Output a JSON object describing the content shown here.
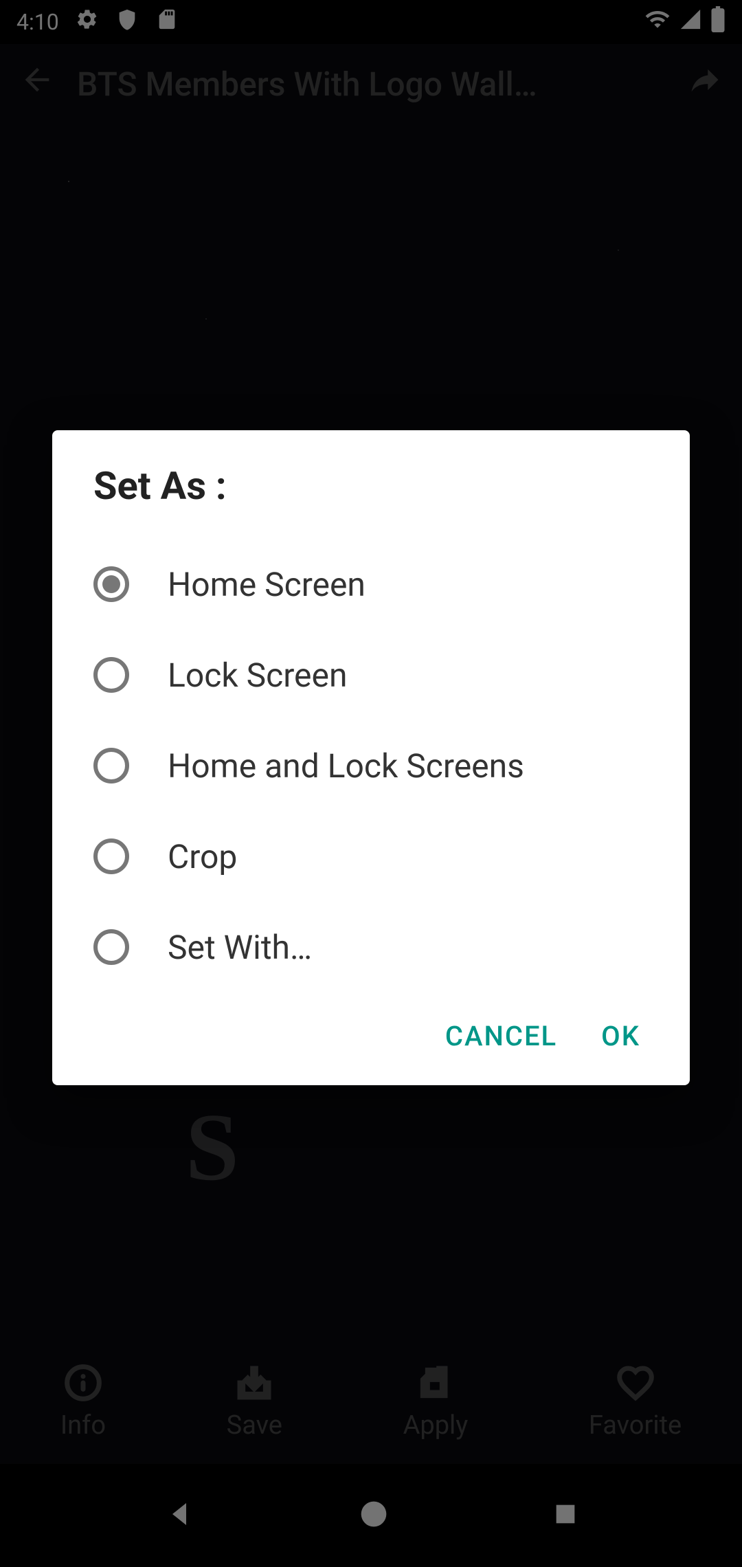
{
  "status": {
    "time": "4:10"
  },
  "appbar": {
    "title": "BTS Members With Logo Wall…"
  },
  "bottom": {
    "info": "Info",
    "save": "Save",
    "apply": "Apply",
    "favorite": "Favorite"
  },
  "dialog": {
    "title": "Set As :",
    "options": [
      {
        "label": "Home Screen",
        "selected": true
      },
      {
        "label": "Lock Screen",
        "selected": false
      },
      {
        "label": "Home and Lock Screens",
        "selected": false
      },
      {
        "label": "Crop",
        "selected": false
      },
      {
        "label": "Set With…",
        "selected": false
      }
    ],
    "cancel": "CANCEL",
    "ok": "OK"
  },
  "bg_text": "B T S"
}
